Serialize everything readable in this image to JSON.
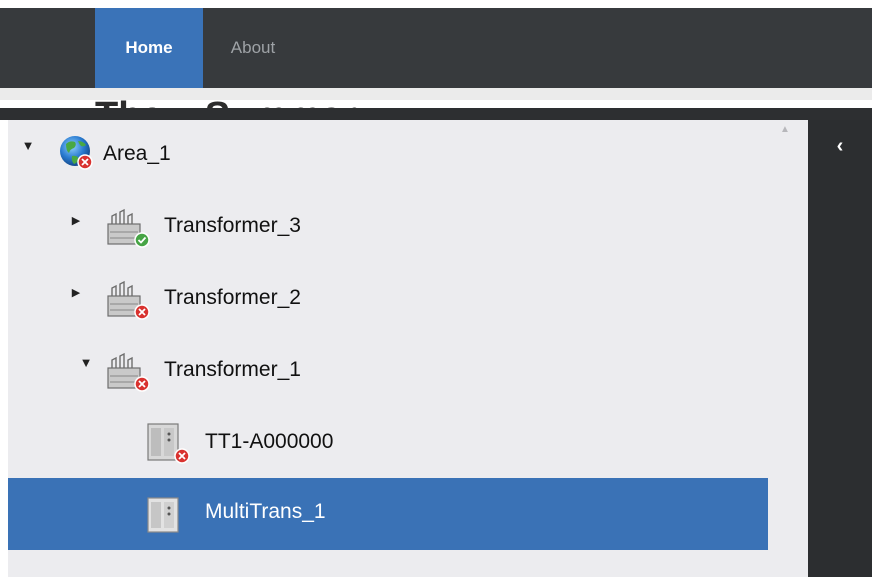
{
  "navbar": {
    "home_label": "Home",
    "about_label": "About",
    "page_title_partial": "The... Summary"
  },
  "sidebar": {
    "collapse_glyph": "‹"
  },
  "tree": {
    "toggle_expanded": "▼",
    "toggle_collapsed": "▶",
    "items": [
      {
        "label": "Area_1",
        "icon": "globe-icon",
        "status": "error",
        "expanded": true
      },
      {
        "label": "Transformer_3",
        "icon": "substation-icon",
        "status": "ok",
        "expanded": false
      },
      {
        "label": "Transformer_2",
        "icon": "substation-icon",
        "status": "error",
        "expanded": false
      },
      {
        "label": "Transformer_1",
        "icon": "substation-icon",
        "status": "error",
        "expanded": true
      },
      {
        "label": "TT1-A000000",
        "icon": "device-icon",
        "status": "error"
      },
      {
        "label": "MultiTrans_1",
        "icon": "device-icon",
        "status": "none",
        "selected": true
      }
    ]
  },
  "colors": {
    "navbar_bg": "#373a3d",
    "accent": "#3a73b8",
    "panel_bg": "#ececef",
    "error": "#d9322f",
    "ok": "#46a445"
  }
}
